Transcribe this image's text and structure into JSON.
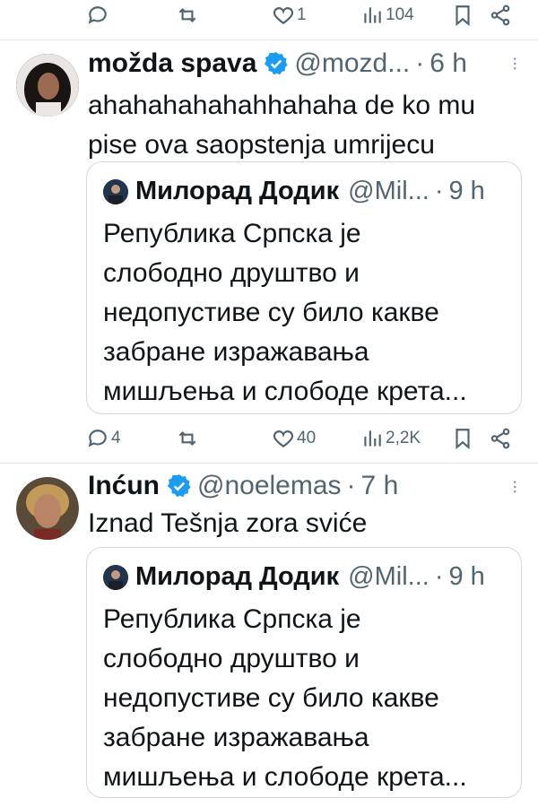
{
  "top_actions": {
    "reply_count": "",
    "retweet_count": "",
    "like_count": "1",
    "views_count": "104"
  },
  "tweet1": {
    "display_name": "možda spava",
    "handle": "@mozd...",
    "time": "6 h",
    "dot": "·",
    "text": "ahahahahahahhahaha de ko mu pise ova saopstenja umrijecu",
    "quote": {
      "display_name": "Милорад Додик",
      "handle": "@Mil...",
      "time": "9 h",
      "dot": "·",
      "text": "Република Српска је слободно друштво и недопустиве су било какве забране изражавања мишљења и слободе крета..."
    },
    "actions": {
      "reply_count": "4",
      "retweet_count": "",
      "like_count": "40",
      "views_count": "2,2K"
    }
  },
  "tweet2": {
    "display_name": "Inćun",
    "handle": "@noelemas",
    "time": "7 h",
    "dot": "·",
    "text": "Iznad Tešnja zora sviće",
    "quote": {
      "display_name": "Милорад Додик",
      "handle": "@Mil...",
      "time": "9 h",
      "dot": "·",
      "text": "Република Српска је слободно друштво и недопустиве су било какве забране изражавања мишљења и слободе крета..."
    }
  },
  "colors": {
    "verified": "#1d9bf0",
    "muted": "#536471",
    "border": "#cfd9de"
  },
  "icons": [
    "reply-icon",
    "retweet-icon",
    "like-icon",
    "views-icon",
    "bookmark-icon",
    "share-icon",
    "verified-badge-icon",
    "more-icon"
  ]
}
